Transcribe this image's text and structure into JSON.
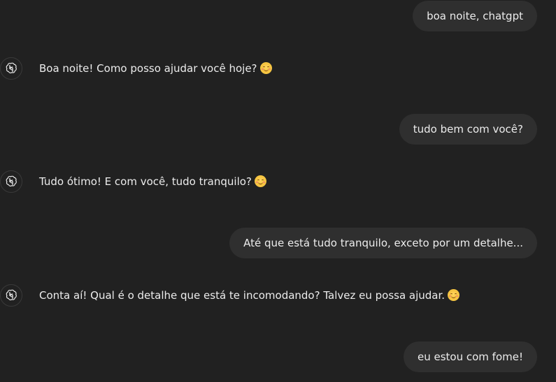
{
  "messages": [
    {
      "role": "user",
      "text": "boa noite, chatgpt"
    },
    {
      "role": "assistant",
      "text": "Boa noite! Como posso ajudar você hoje?",
      "emoji": "smiling-face-icon"
    },
    {
      "role": "user",
      "text": "tudo bem com você?"
    },
    {
      "role": "assistant",
      "text": "Tudo ótimo! E com você, tudo tranquilo?",
      "emoji": "smiling-face-icon"
    },
    {
      "role": "user",
      "text": "Até que está tudo tranquilo, exceto por um detalhe..."
    },
    {
      "role": "assistant",
      "text": "Conta aí! Qual é o detalhe que está te incomodando? Talvez eu possa ajudar.",
      "emoji": "smiling-face-icon"
    },
    {
      "role": "user",
      "text": "eu estou com fome!"
    }
  ],
  "assistant_avatar_icon": "openai-logo-icon",
  "colors": {
    "background": "#212121",
    "user_bubble": "#2f2f2f",
    "text": "#ececec"
  }
}
